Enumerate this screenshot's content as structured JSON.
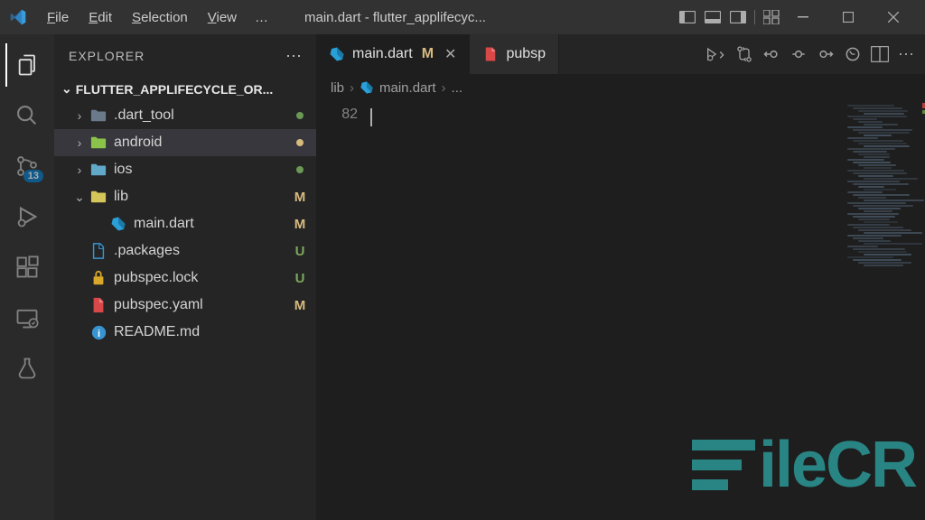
{
  "titlebar": {
    "menu": [
      "File",
      "Edit",
      "Selection",
      "View"
    ],
    "ellipsis": "…",
    "title": "main.dart - flutter_applifecyc..."
  },
  "sidebar": {
    "title": "EXPLORER",
    "project": "FLUTTER_APPLIFECYCLE_OR..."
  },
  "tree": [
    {
      "name": ".dart_tool",
      "type": "folder",
      "expanded": false,
      "indent": 1,
      "dot": "green",
      "folderColor": "#6a7a8a"
    },
    {
      "name": "android",
      "type": "folder",
      "expanded": false,
      "indent": 1,
      "dot": "yellow",
      "selected": true,
      "folderColor": "#8bc34a"
    },
    {
      "name": "ios",
      "type": "folder",
      "expanded": false,
      "indent": 1,
      "dot": "green",
      "folderColor": "#61a9c9"
    },
    {
      "name": "lib",
      "type": "folder",
      "expanded": true,
      "indent": 1,
      "status": "M",
      "statusClass": "m",
      "folderColor": "#d4c658"
    },
    {
      "name": "main.dart",
      "type": "dart",
      "indent": 2,
      "status": "M",
      "statusClass": "m"
    },
    {
      "name": ".packages",
      "type": "file-blue",
      "indent": 1,
      "status": "U",
      "statusClass": "u"
    },
    {
      "name": "pubspec.lock",
      "type": "lock",
      "indent": 1,
      "status": "U",
      "statusClass": "u"
    },
    {
      "name": "pubspec.yaml",
      "type": "yaml",
      "indent": 1,
      "status": "M",
      "statusClass": "m"
    },
    {
      "name": "README.md",
      "type": "info",
      "indent": 1
    }
  ],
  "tabs": [
    {
      "name": "main.dart",
      "icon": "dart",
      "status": "M",
      "active": true,
      "close": true
    },
    {
      "name": "pubsp",
      "icon": "yaml",
      "truncated": true
    }
  ],
  "breadcrumb": {
    "folder": "lib",
    "file": "main.dart",
    "trailing": "..."
  },
  "editor": {
    "lineNumber": "82"
  },
  "activityBadge": "13",
  "watermark": "FileCR"
}
